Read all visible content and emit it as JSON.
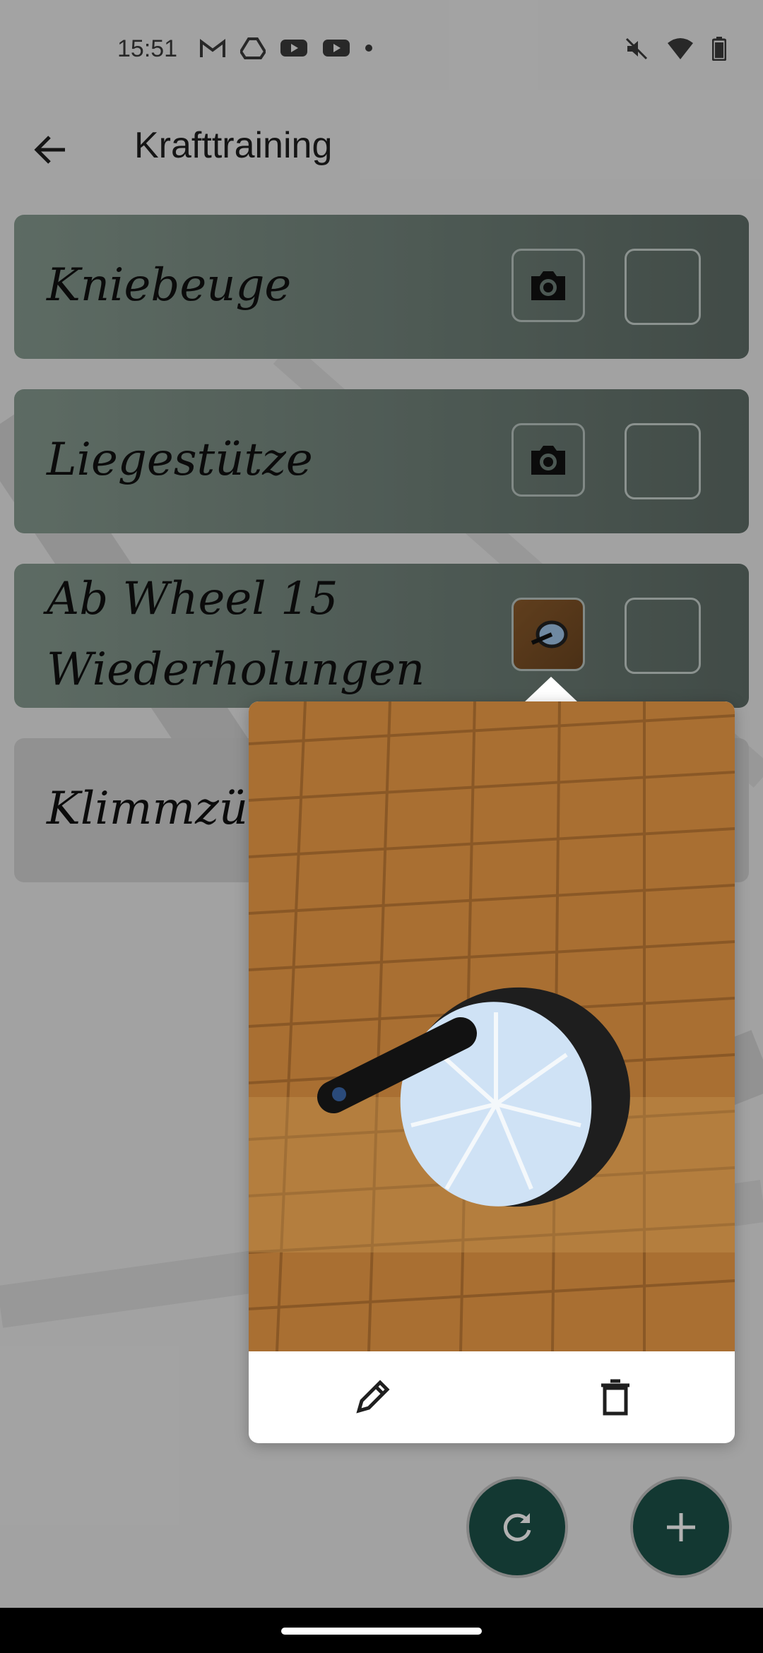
{
  "status_bar": {
    "time": "15:51",
    "left_icons": [
      "gmail-icon",
      "drive-icon",
      "youtube-icon",
      "youtube-icon",
      "dot-icon"
    ],
    "right_icons": [
      "mute-icon",
      "wifi-icon",
      "battery-icon"
    ]
  },
  "app_bar": {
    "title": "Krafttraining",
    "back_icon": "arrow-back-icon"
  },
  "exercises": [
    {
      "label": "Kniebeuge",
      "photo": "camera-icon",
      "checked": false
    },
    {
      "label": "Liegestütze",
      "photo": "camera-icon",
      "checked": false
    },
    {
      "label": "Ab Wheel 15 Wiederholungen",
      "photo": "thumbnail",
      "checked": false
    },
    {
      "label": "Klimmzüg",
      "photo": "camera-icon",
      "checked": false
    }
  ],
  "popup": {
    "photo_subject": "ab wheel on parquet floor",
    "actions": [
      "edit-icon",
      "delete-icon"
    ]
  },
  "fabs": [
    "refresh-icon",
    "add-icon"
  ],
  "colors": {
    "card": "#6e7f77",
    "fab": "#1c5148",
    "scrim": "rgba(0,0,0,0.30)"
  }
}
